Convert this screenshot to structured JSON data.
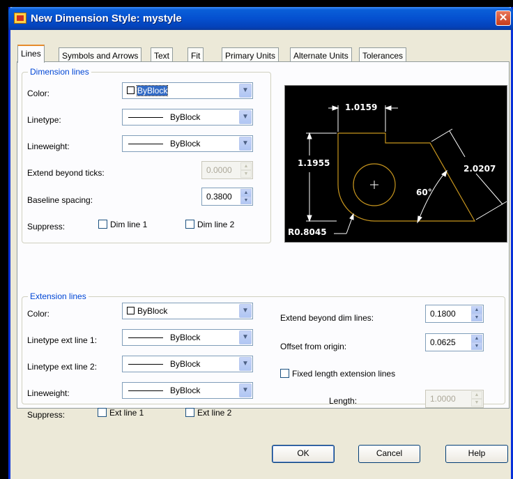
{
  "window": {
    "title": "New Dimension Style: mystyle",
    "close_label": "✕"
  },
  "tabs": [
    {
      "label": "Lines"
    },
    {
      "label": "Symbols and Arrows"
    },
    {
      "label": "Text"
    },
    {
      "label": "Fit"
    },
    {
      "label": "Primary Units"
    },
    {
      "label": "Alternate Units"
    },
    {
      "label": "Tolerances"
    }
  ],
  "dimension_lines": {
    "title": "Dimension lines",
    "color_label": "Color:",
    "color_value": "ByBlock",
    "linetype_label": "Linetype:",
    "linetype_value": "ByBlock",
    "lineweight_label": "Lineweight:",
    "lineweight_value": "ByBlock",
    "extend_label": "Extend beyond ticks:",
    "extend_value": "0.0000",
    "baseline_label": "Baseline spacing:",
    "baseline_value": "0.3800",
    "suppress_label": "Suppress:",
    "suppress_1": "Dim line 1",
    "suppress_2": "Dim line 2"
  },
  "extension_lines": {
    "title": "Extension lines",
    "color_label": "Color:",
    "color_value": "ByBlock",
    "lt1_label": "Linetype ext line 1:",
    "lt1_value": "ByBlock",
    "lt2_label": "Linetype ext line 2:",
    "lt2_value": "ByBlock",
    "lineweight_label": "Lineweight:",
    "lineweight_value": "ByBlock",
    "suppress_label": "Suppress:",
    "suppress_1": "Ext line 1",
    "suppress_2": "Ext line 2",
    "extend_label": "Extend beyond dim lines:",
    "extend_value": "0.1800",
    "offset_label": "Offset from origin:",
    "offset_value": "0.0625",
    "fixed_label": "Fixed length extension lines",
    "length_label": "Length:",
    "length_value": "1.0000"
  },
  "preview": {
    "dim_top": "1.0159",
    "dim_left": "1.1955",
    "dim_right": "2.0207",
    "dim_angle": "60°",
    "dim_radius": "R0.8045",
    "geometry_color": "#c8961e"
  },
  "buttons": {
    "ok": "OK",
    "cancel": "Cancel",
    "help": "Help"
  },
  "colors": {
    "titlebar": "#0550d0",
    "group_title": "#0046d5",
    "close": "#c53a1a"
  }
}
